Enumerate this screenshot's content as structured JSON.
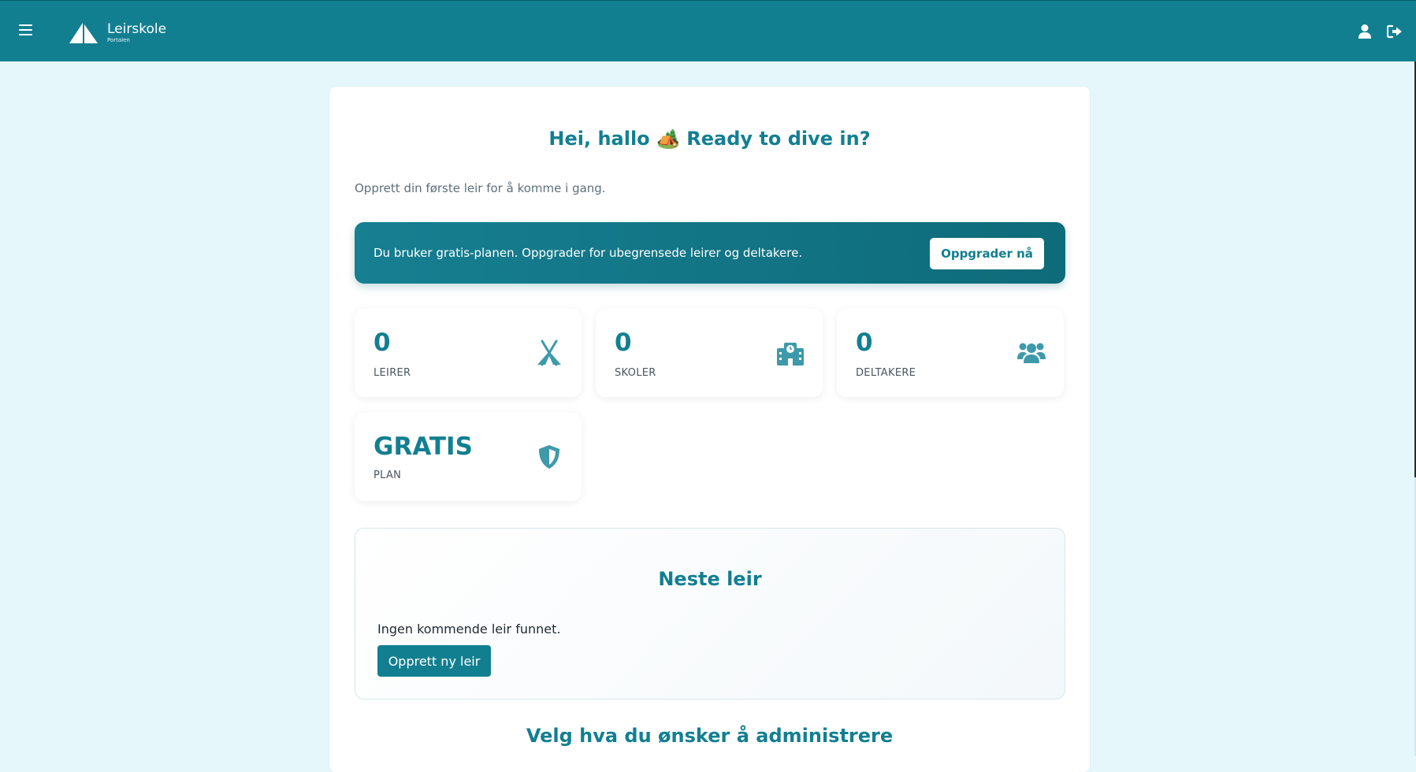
{
  "header": {
    "brand_name": "Leirskole",
    "brand_sub": "Portalen",
    "menu_icon": "hamburger-icon",
    "user_icon": "user-icon",
    "logout_icon": "logout-icon"
  },
  "main": {
    "greeting": "Hei, hallo 🏕️ Ready to dive in?",
    "intro": "Opprett din første leir for å komme i gang.",
    "banner": {
      "text": "Du bruker gratis-planen. Oppgrader for ubegrensede leirer og deltakere.",
      "button_label": "Oppgrader nå"
    },
    "stats": [
      {
        "value": "0",
        "label": "LEIRER",
        "icon": "tent-icon"
      },
      {
        "value": "0",
        "label": "SKOLER",
        "icon": "school-icon"
      },
      {
        "value": "0",
        "label": "DELTAKERE",
        "icon": "users-icon"
      },
      {
        "value": "GRATIS",
        "label": "PLAN",
        "icon": "shield-icon"
      }
    ],
    "next_camp": {
      "title": "Neste leir",
      "empty_text": "Ingen kommende leir funnet.",
      "button_label": "Opprett ny leir"
    },
    "manage_title": "Velg hva du ønsker å administrere"
  },
  "colors": {
    "primary": "#127f91",
    "background": "#e6f7fb",
    "icon": "#3e9aaa"
  }
}
